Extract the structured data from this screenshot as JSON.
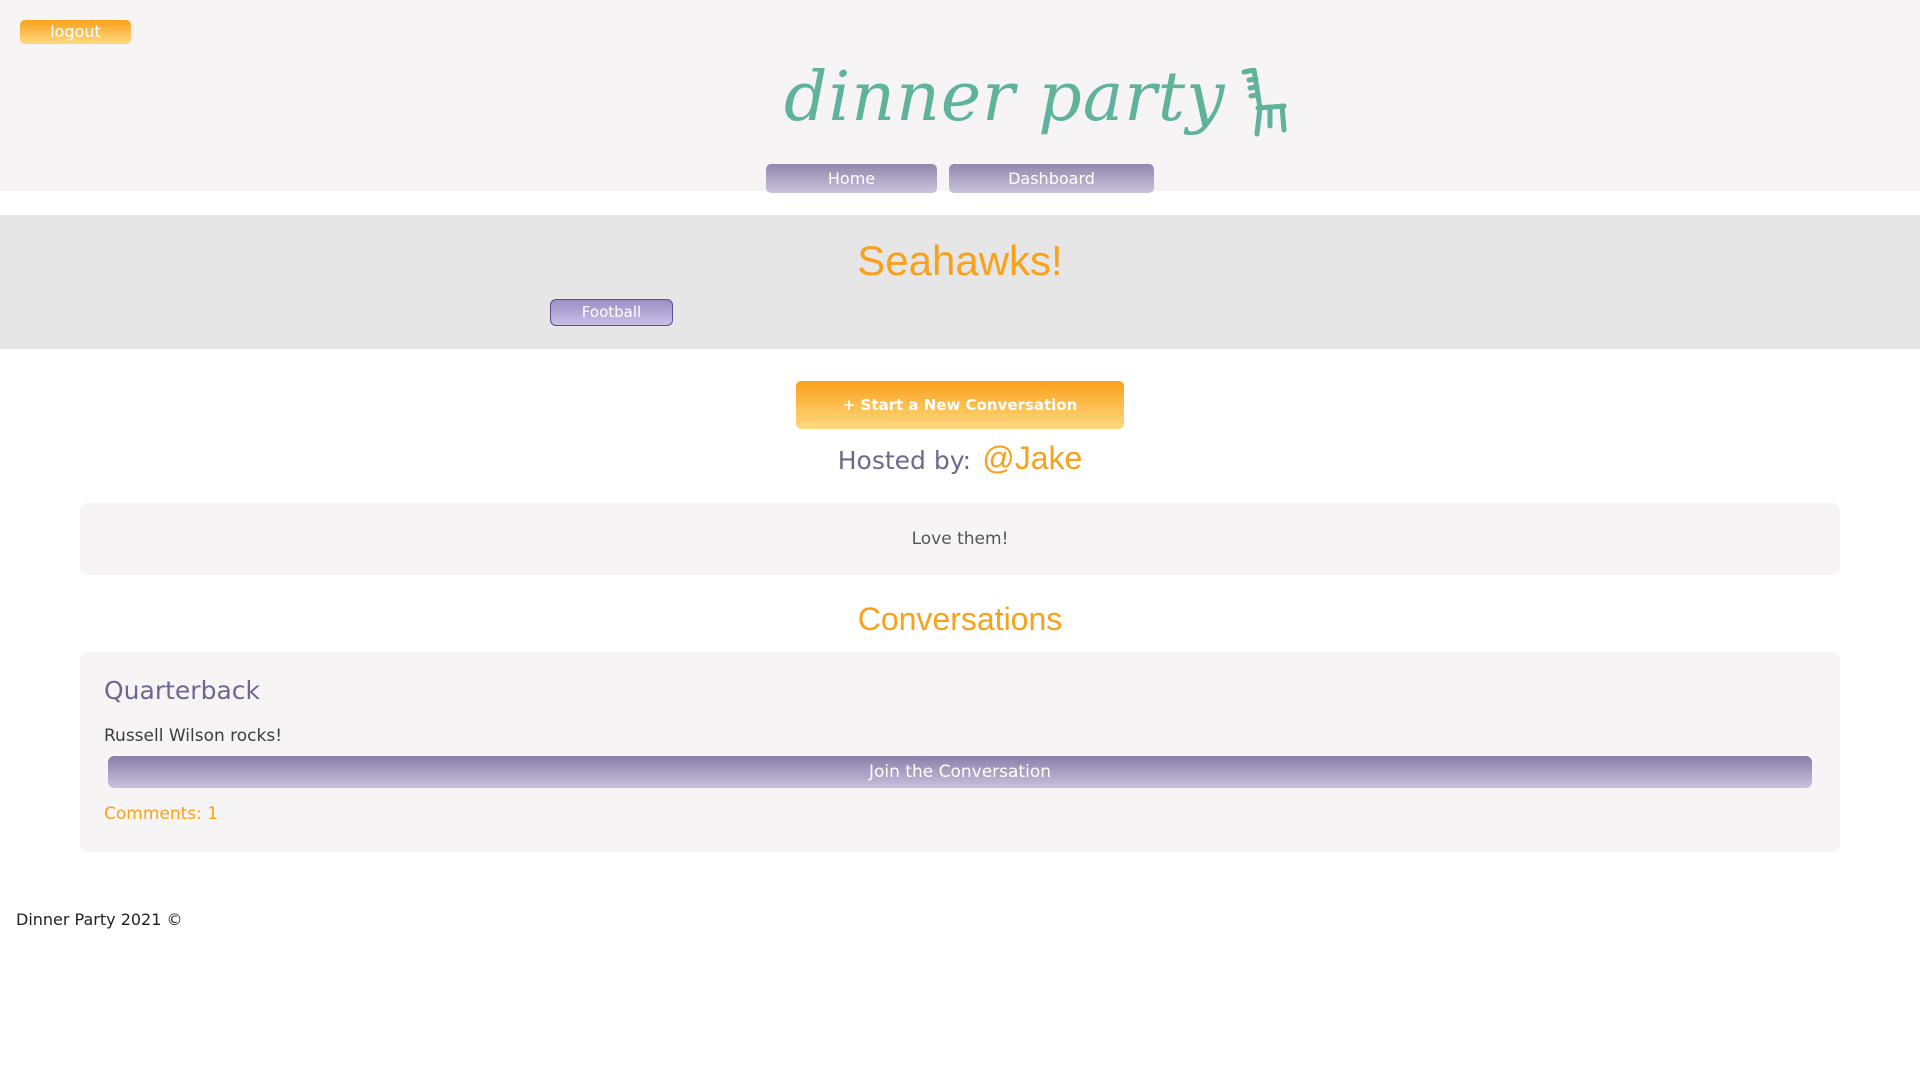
{
  "header": {
    "logout_label": "logout",
    "logo_text": "dinner party",
    "logo_icon": "chair-icon",
    "nav": {
      "home_label": "Home",
      "dashboard_label": "Dashboard"
    }
  },
  "banner": {
    "title": "Seahawks!",
    "tag_label": "Football"
  },
  "main": {
    "start_conversation_label": "+ Start a New Conversation",
    "hosted_label": "Hosted by:",
    "host_handle": "@Jake",
    "description": "Love them!",
    "conversations_heading": "Conversations",
    "conversations": [
      {
        "title": "Quarterback",
        "body": "Russell Wilson rocks!",
        "join_label": "Join the Conversation",
        "comments_label": "Comments: 1"
      }
    ]
  },
  "footer": {
    "text": "Dinner Party 2021 ©"
  },
  "colors": {
    "accent_orange": "#f9a11b",
    "brand_teal": "#5fb29c",
    "purple": "#6f6790",
    "panel_gray": "#e6e6e6",
    "header_bg": "#f6f4f5"
  }
}
